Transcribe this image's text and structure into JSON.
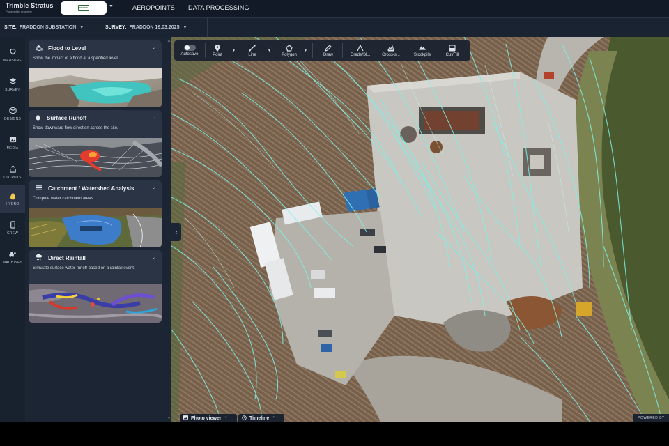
{
  "app": {
    "brand_name": "Trimble Stratus",
    "brand_tagline": "Powered by propeller",
    "org_logo_text": "FRADDON",
    "nav": [
      "AEROPOINTS",
      "DATA PROCESSING"
    ]
  },
  "context": {
    "site_label": "SITE:",
    "site_value": "FRADDON SUBSTATION",
    "survey_label": "SURVEY:",
    "survey_value": "FRADDON 19.03.2025"
  },
  "rail": [
    {
      "label": "MEASURE",
      "icon": "measure-icon"
    },
    {
      "label": "SURVEY",
      "icon": "layers-icon"
    },
    {
      "label": "DESIGNS",
      "icon": "cube-icon"
    },
    {
      "label": "MEDIA",
      "icon": "image-icon"
    },
    {
      "label": "OUTPUTS",
      "icon": "export-icon"
    },
    {
      "label": "HYDRO",
      "icon": "water-drop-icon",
      "active": true
    },
    {
      "label": "CREW",
      "icon": "phone-icon"
    },
    {
      "label": "MACHINES",
      "icon": "excavator-icon"
    }
  ],
  "cards": [
    {
      "title": "Flood to Level",
      "desc": "Show the impact of a flood at a specified level.",
      "icon": "flood-icon"
    },
    {
      "title": "Surface Runoff",
      "desc": "Show downward flow direction across the site.",
      "icon": "drop-icon"
    },
    {
      "title": "Catchment / Watershed Analysis",
      "desc": "Compute water catchment areas.",
      "icon": "lines-icon"
    },
    {
      "title": "Direct Rainfall",
      "desc": "Simulate surface water runoff based on a rainfall event.",
      "icon": "rain-cloud-icon"
    }
  ],
  "toolbar": {
    "autosave": "Autosave",
    "point": "Point",
    "line": "Line",
    "polygon": "Polygon",
    "draw": "Draw",
    "grade": "Grade/Sl...",
    "cross": "Cross-s...",
    "stockpile": "Stockpile",
    "cutfill": "Cut/Fill"
  },
  "bottom": {
    "photo_viewer": "Photo viewer",
    "timeline": "Timeline",
    "powered": "POWERED BY"
  },
  "colors": {
    "accent": "#f2c94c",
    "flow_lines": "#7ff0e6",
    "panel_bg": "#1c2533",
    "card_bg": "#2a3444",
    "topbar_bg": "#111a26"
  }
}
